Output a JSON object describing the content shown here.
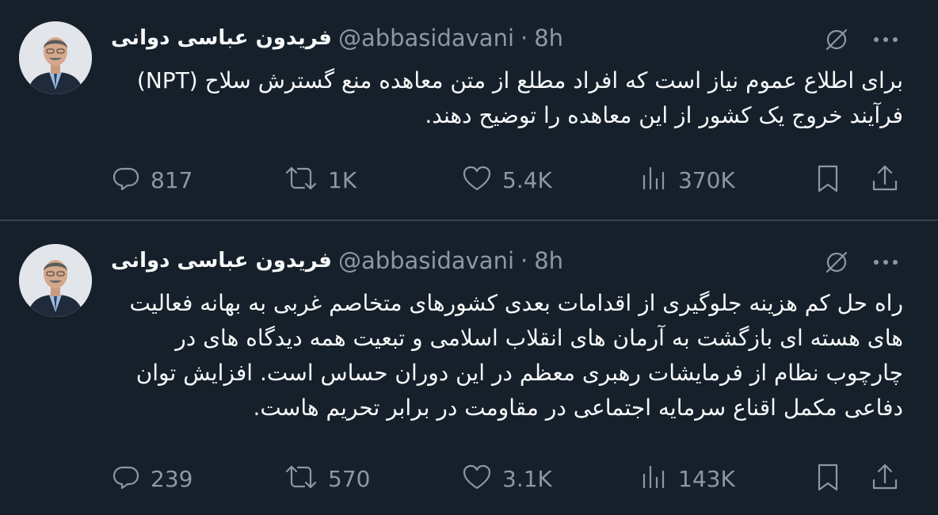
{
  "tweets": [
    {
      "author": {
        "display_name": "فریدون عباسی دوانی",
        "handle": "@abbasidavani",
        "separator": "·",
        "time": "8h"
      },
      "text": "برای اطلاع عموم نیاز است که افراد مطلع از متن معاهده منع گسترش سلاح (NPT) فرآیند خروج یک کشور از این معاهده را توضیح دهند.",
      "actions": {
        "replies": "817",
        "reposts": "1K",
        "likes": "5.4K",
        "views": "370K"
      }
    },
    {
      "author": {
        "display_name": "فریدون عباسی دوانی",
        "handle": "@abbasidavani",
        "separator": "·",
        "time": "8h"
      },
      "text": "راه حل کم هزینه جلوگیری از اقدامات بعدی کشورهای متخاصم غربی به بهانه فعالیت های هسته ای بازگشت به آرمان های انقلاب اسلامی و تبعیت همه دیدگاه های در چارچوب نظام از فرمایشات رهبری معظم در این دوران حساس است. افزایش توان دفاعی مکمل اقناع سرمایه اجتماعی در مقاومت در برابر تحریم هاست.",
      "actions": {
        "replies": "239",
        "reposts": "570",
        "likes": "3.1K",
        "views": "143K"
      }
    }
  ],
  "icons": {
    "reply": "reply-icon",
    "repost": "repost-icon",
    "like": "heart-icon",
    "views": "views-icon",
    "bookmark": "bookmark-icon",
    "share": "share-icon",
    "grok": "grok-icon",
    "more": "more-icon"
  },
  "colors": {
    "background": "#15202b",
    "text": "#f7f9f9",
    "secondary": "#8b98a5",
    "divider": "#38444d"
  }
}
